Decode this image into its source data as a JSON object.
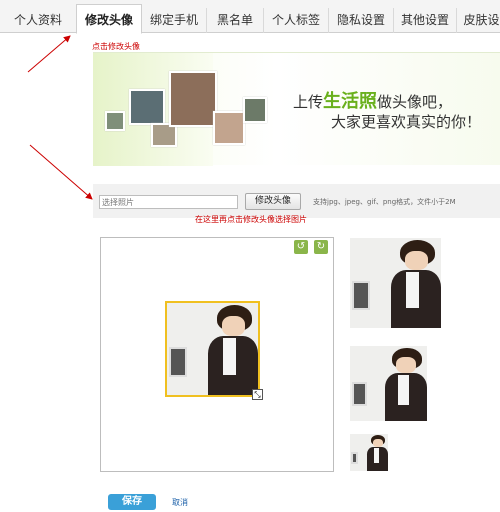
{
  "tabs": [
    {
      "label": "个人资料"
    },
    {
      "label": "修改头像",
      "active": true
    },
    {
      "label": "绑定手机"
    },
    {
      "label": "黑名单"
    },
    {
      "label": "个人标签"
    },
    {
      "label": "隐私设置"
    },
    {
      "label": "其他设置"
    },
    {
      "label": "皮肤设"
    }
  ],
  "hints": {
    "click_tab": "点击修改头像",
    "click_button": "在这里再点击修改头像选择图片"
  },
  "banner": {
    "line1_prefix": "上传",
    "line1_highlight": "生活照",
    "line1_suffix": "做头像吧，",
    "line2": "大家更喜欢真实的你！"
  },
  "upload": {
    "placeholder": "选择照片",
    "button_label": "修改头像",
    "support_text": "支持jpg、jpeg、gif、png格式，文件小于2M"
  },
  "editor": {
    "rotate_left_icon": "rotate-ccw",
    "rotate_right_icon": "rotate-cw"
  },
  "actions": {
    "save_label": "保存",
    "cancel_label": "取消"
  },
  "colors": {
    "accent_red": "#cc0000",
    "banner_green": "#69b01c",
    "save_blue": "#3aa0d8",
    "crop_border": "#f0c020"
  }
}
